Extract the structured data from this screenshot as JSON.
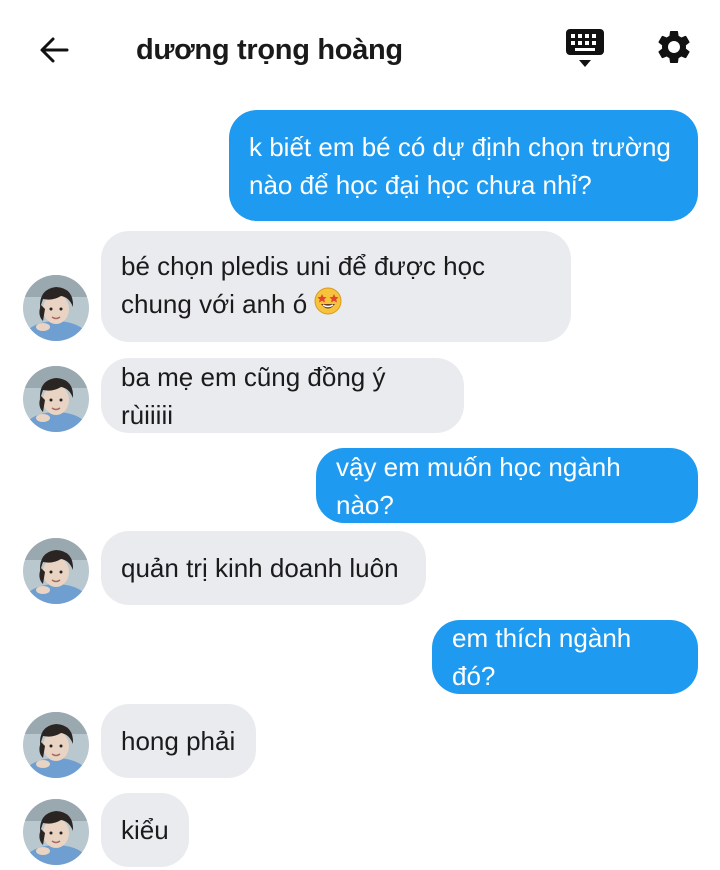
{
  "header": {
    "back_icon": "arrow-left-icon",
    "title": "dương trọng hoàng",
    "keyboard_icon": "keyboard-icon",
    "settings_icon": "gear-icon"
  },
  "colors": {
    "outgoing_bubble": "#1e9bf0",
    "incoming_bubble": "#e9ebee",
    "text": "#1b1b1b"
  },
  "messages": [
    {
      "direction": "out",
      "lines": [
        "k biết em bé có dự định chọn trường",
        "nào để học đại học chưa nhỉ?"
      ]
    },
    {
      "direction": "in",
      "lines": [
        "bé chọn pledis uni để được học",
        "chung với anh ó"
      ],
      "emoji": "star-struck-emoji"
    },
    {
      "direction": "in",
      "lines": [
        "ba mẹ em cũng đồng ý rùiiiii"
      ]
    },
    {
      "direction": "out",
      "lines": [
        "vậy em muốn học ngành nào?"
      ]
    },
    {
      "direction": "in",
      "lines": [
        "quản trị kinh doanh luôn"
      ]
    },
    {
      "direction": "out",
      "lines": [
        "em thích ngành đó?"
      ]
    },
    {
      "direction": "in",
      "lines": [
        "hong phải"
      ]
    },
    {
      "direction": "in",
      "lines": [
        "kiểu"
      ]
    }
  ]
}
